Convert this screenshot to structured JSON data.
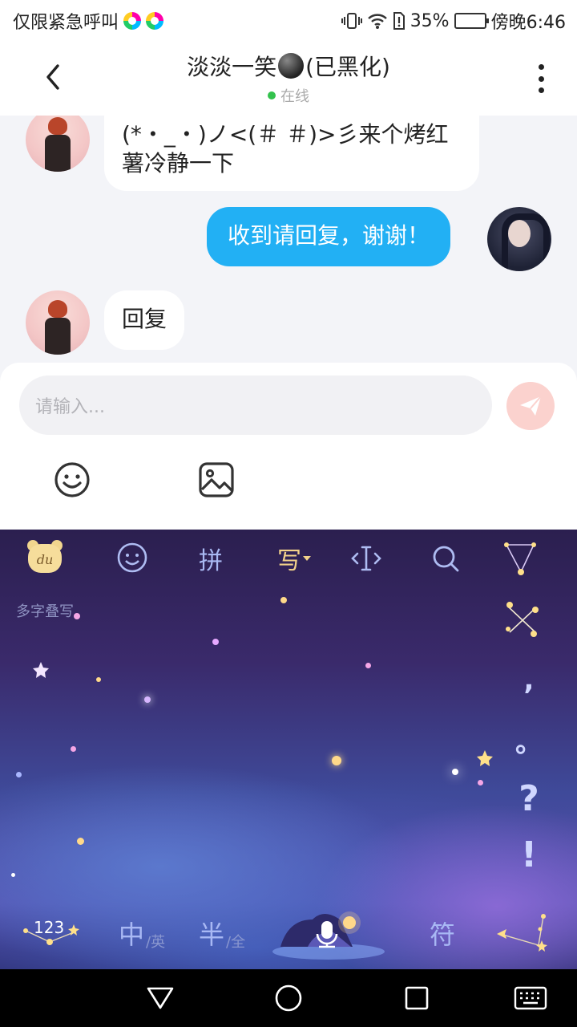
{
  "status_bar": {
    "left_text": "仅限紧急呼叫",
    "battery_percent": "35%",
    "battery_level": 0.35,
    "time": "傍晚6:46"
  },
  "header": {
    "title_prefix": "淡淡一笑",
    "title_suffix": "(已黑化)",
    "status": "在线"
  },
  "messages": [
    {
      "side": "in",
      "text_line1": "(*・_・)ノ<(＃ ＃)>彡来个烤红",
      "text_line2": "薯冷静一下"
    },
    {
      "side": "out",
      "text": "收到请回复，谢谢！"
    },
    {
      "side": "in",
      "text": "回复"
    }
  ],
  "input": {
    "placeholder": "请输入..."
  },
  "keyboard": {
    "mode_pinyin": "拼",
    "mode_handwrite": "写",
    "multi_char_hint": "多字叠写",
    "punctuation": [
      ",",
      "。",
      "?",
      "!"
    ],
    "key_numbers": "123",
    "key_chinese": "中",
    "key_chinese_sub": "/英",
    "key_half": "半",
    "key_half_sub": "/全",
    "key_symbols": "符"
  },
  "colors": {
    "accent_blue": "#22b0f4",
    "send_button": "#fbd2ce",
    "online_green": "#33c24d"
  }
}
